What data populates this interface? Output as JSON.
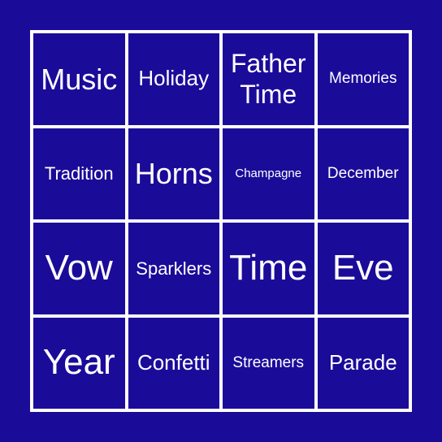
{
  "board": {
    "colors": {
      "background": "#1b0b99",
      "grid_lines": "#ffffff",
      "text": "#ffffff"
    },
    "cells": [
      {
        "label": "Music",
        "size": "s-lg"
      },
      {
        "label": "Holiday",
        "size": "s-md"
      },
      {
        "label": "Father Time",
        "size": "s-ml"
      },
      {
        "label": "Memories",
        "size": "s-xs"
      },
      {
        "label": "Tradition",
        "size": "s-sm"
      },
      {
        "label": "Horns",
        "size": "s-lg"
      },
      {
        "label": "Champagne",
        "size": "s-xxs"
      },
      {
        "label": "December",
        "size": "s-xs"
      },
      {
        "label": "Vow",
        "size": "s-xl"
      },
      {
        "label": "Sparklers",
        "size": "s-sm"
      },
      {
        "label": "Time",
        "size": "s-xl"
      },
      {
        "label": "Eve",
        "size": "s-xl"
      },
      {
        "label": "Year",
        "size": "s-xl"
      },
      {
        "label": "Confetti",
        "size": "s-md"
      },
      {
        "label": "Streamers",
        "size": "s-xs"
      },
      {
        "label": "Parade",
        "size": "s-md"
      }
    ]
  }
}
